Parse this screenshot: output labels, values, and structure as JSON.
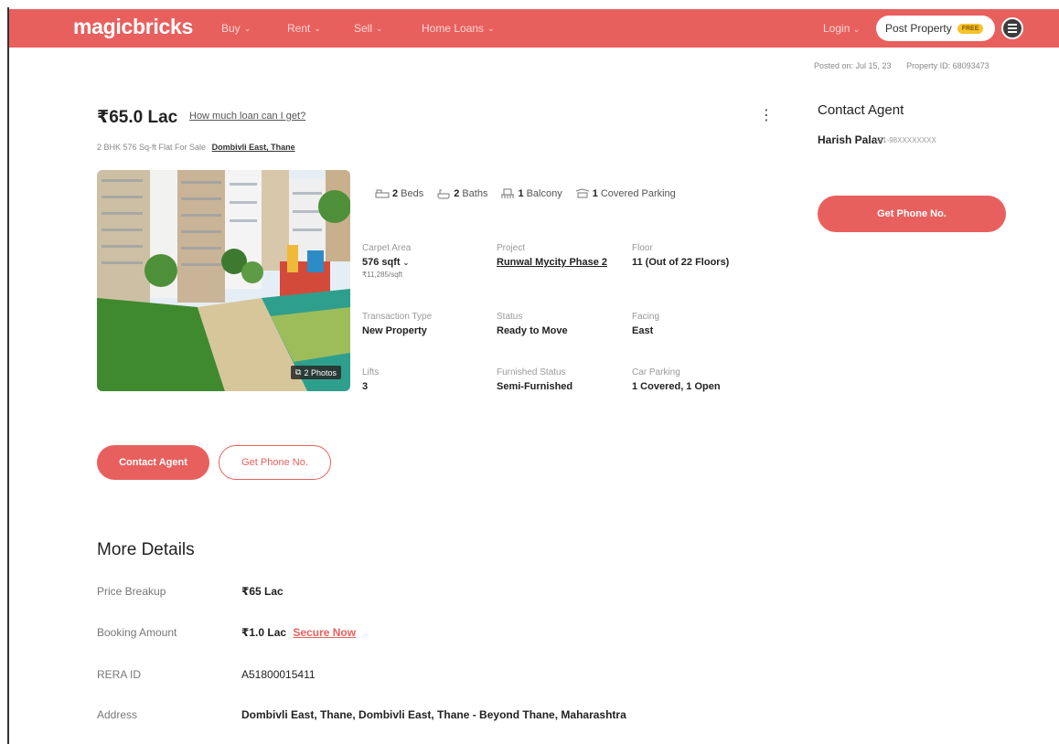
{
  "brand": {
    "logo_text": "magicbricks",
    "accent": "#e8605e"
  },
  "nav": {
    "items": [
      {
        "label": "Buy"
      },
      {
        "label": "Rent"
      },
      {
        "label": "Sell"
      },
      {
        "label": "Home Loans"
      }
    ],
    "login_label": "Login",
    "post_property_label": "Post Property",
    "free_badge": "FREE"
  },
  "meta": {
    "posted_on": "Posted on: Jul 15, 23",
    "property_id": "Property ID: 68093473"
  },
  "listing": {
    "price": "₹65.0 Lac",
    "loan_link": "How much loan can I get?",
    "subtitle_prefix": "2 BHK 576 Sq-ft Flat For Sale",
    "subtitle_location": "Dombivli East, Thane",
    "photo_badge": "2 Photos",
    "amenities": [
      {
        "value": "2",
        "label": "Beds",
        "icon": "bed-icon"
      },
      {
        "value": "2",
        "label": "Baths",
        "icon": "bath-icon"
      },
      {
        "value": "1",
        "label": "Balcony",
        "icon": "balcony-icon"
      },
      {
        "value": "1",
        "label": "Covered Parking",
        "icon": "car-icon"
      }
    ],
    "attributes": {
      "carpet_area": {
        "label": "Carpet Area",
        "value": "576 sqft",
        "sub": "₹11,285/sqft"
      },
      "project": {
        "label": "Project",
        "value": "Runwal Mycity Phase 2"
      },
      "floor": {
        "label": "Floor",
        "value": "11 (Out of 22 Floors)"
      },
      "transaction_type": {
        "label": "Transaction Type",
        "value": "New Property"
      },
      "status": {
        "label": "Status",
        "value": "Ready to Move"
      },
      "facing": {
        "label": "Facing",
        "value": "East"
      },
      "lifts": {
        "label": "Lifts",
        "value": "3"
      },
      "furnished_status": {
        "label": "Furnished Status",
        "value": "Semi-Furnished"
      },
      "car_parking": {
        "label": "Car Parking",
        "value": "1 Covered, 1 Open"
      }
    },
    "buttons": {
      "contact_agent": "Contact Agent",
      "get_phone": "Get Phone No."
    }
  },
  "contact_panel": {
    "title": "Contact Agent",
    "agent_name": "Harish Palav",
    "agent_phone": "+91-98XXXXXXXX",
    "button": "Get Phone No."
  },
  "more_details": {
    "title": "More Details",
    "rows": [
      {
        "key": "Price Breakup",
        "value": "₹65 Lac",
        "link": ""
      },
      {
        "key": "Booking Amount",
        "value": "₹1.0 Lac",
        "link": "Secure Now"
      },
      {
        "key": "RERA ID",
        "value": "A51800015411",
        "link": ""
      },
      {
        "key": "Address",
        "value": "Dombivli East, Thane, Dombivli East, Thane - Beyond Thane, Maharashtra",
        "link": ""
      }
    ]
  }
}
